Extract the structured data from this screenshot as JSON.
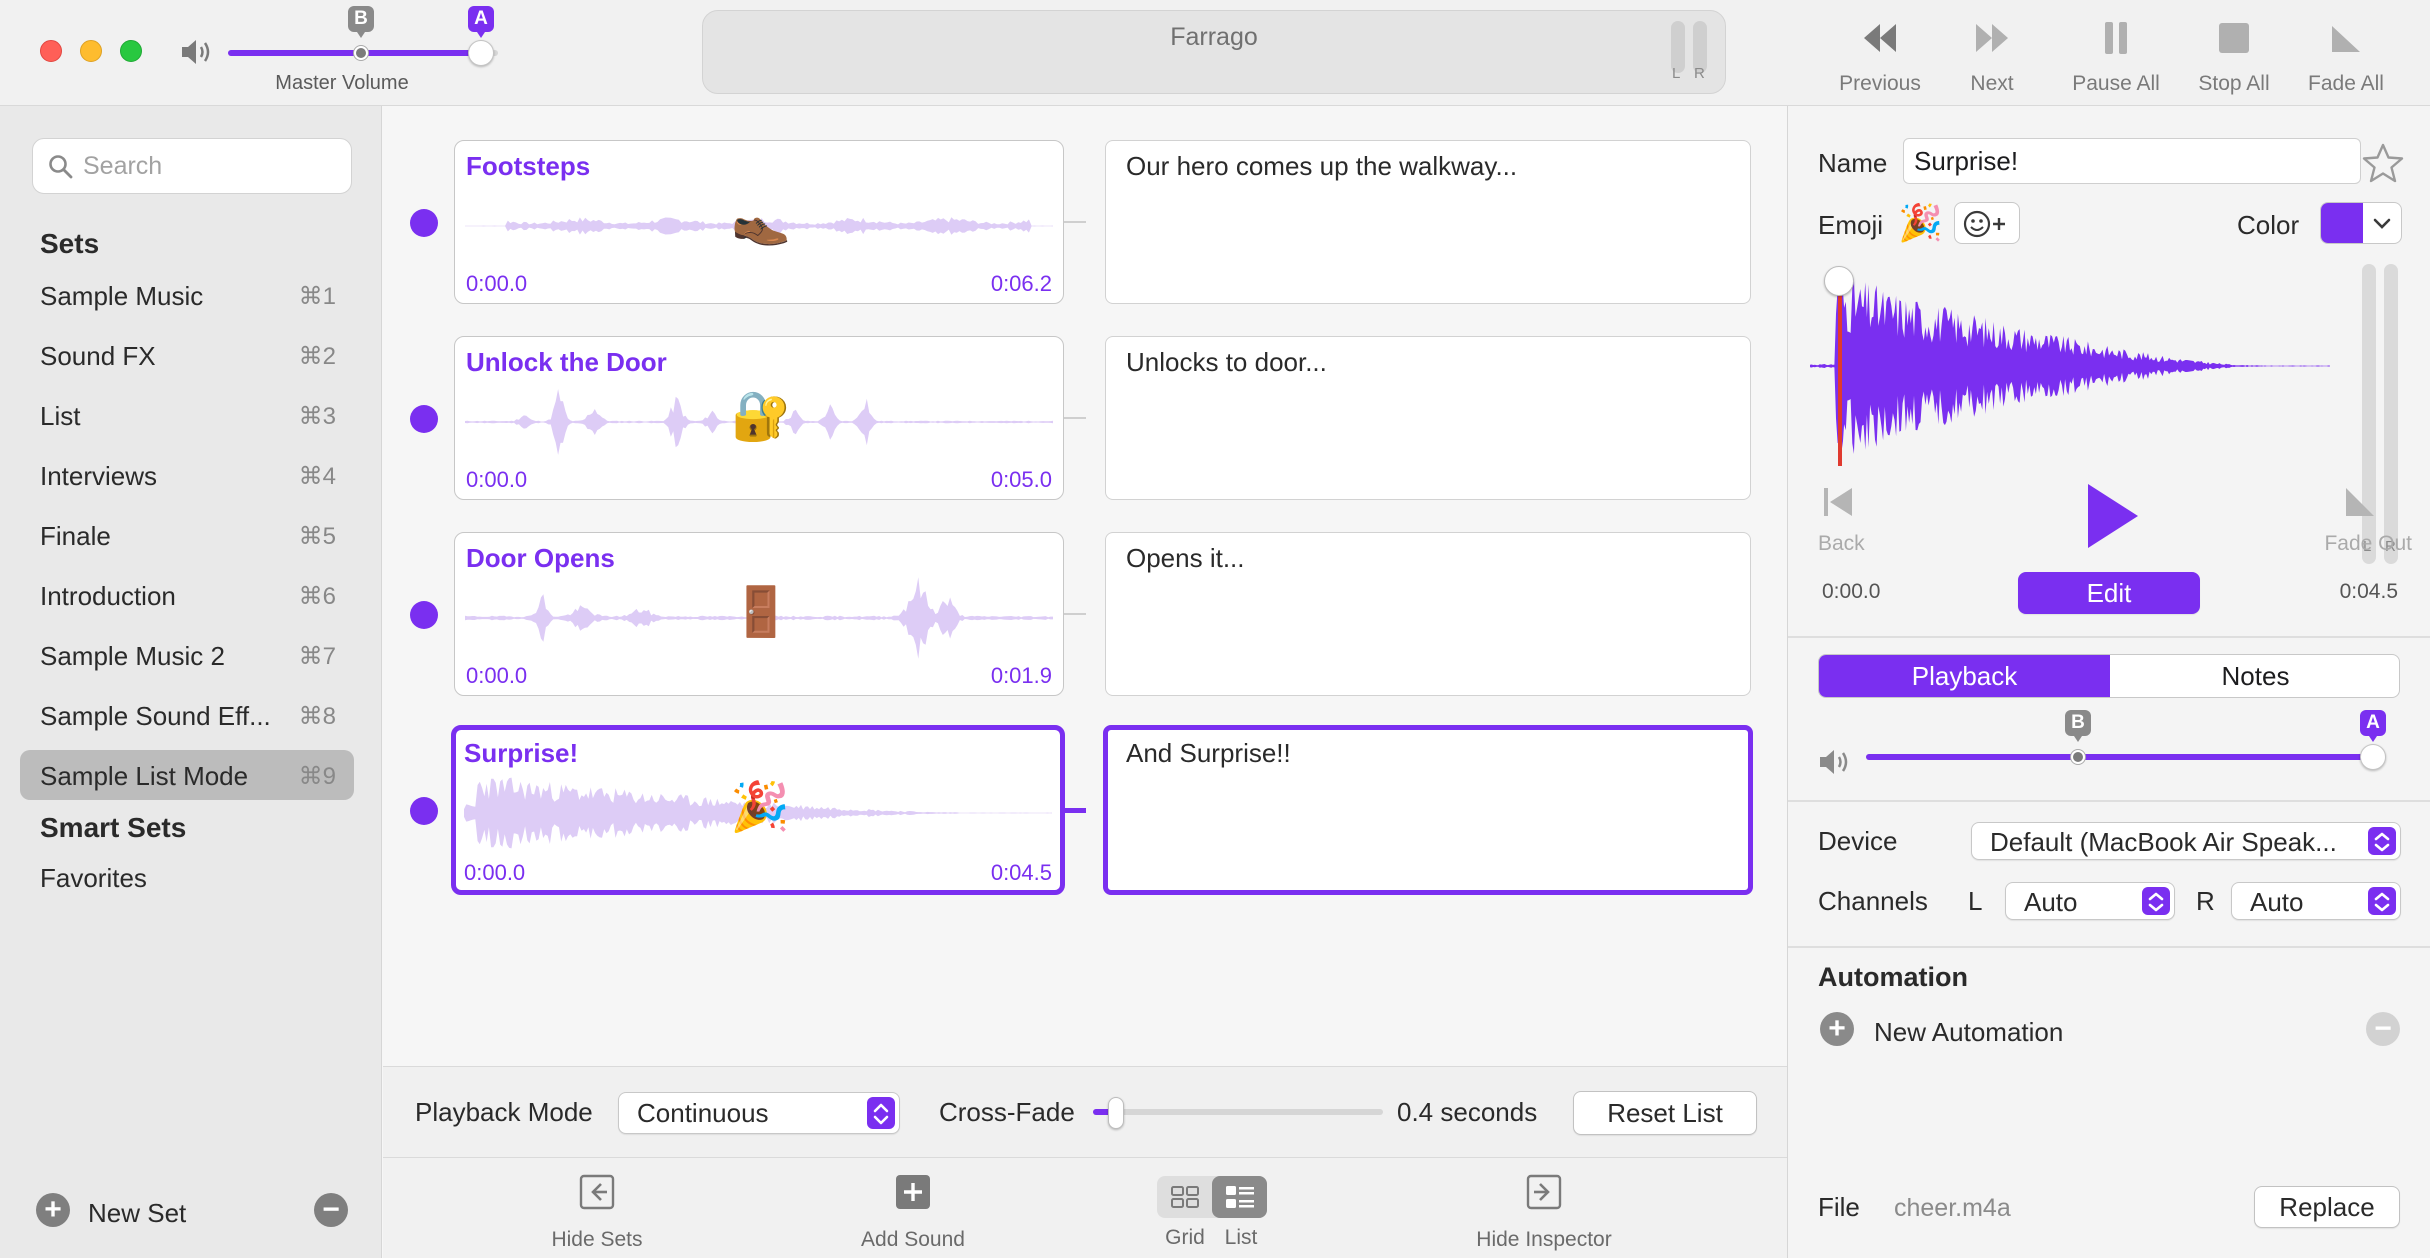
{
  "colors": {
    "accent": "#7a2ff0",
    "waveform_light": "#ddccf6",
    "playhead": "#e03a2f"
  },
  "titlebar": {
    "app_title": "Farrago",
    "master_volume_label": "Master Volume",
    "volume_badge_b": "B",
    "volume_badge_a": "A",
    "master_volume_level": 1.0,
    "master_volume_b_level": 0.53,
    "meter_l": "L",
    "meter_r": "R",
    "buttons": {
      "previous": "Previous",
      "next": "Next",
      "pause_all": "Pause All",
      "stop_all": "Stop All",
      "fade_all": "Fade All"
    }
  },
  "sidebar": {
    "search_placeholder": "Search",
    "sets_heading": "Sets",
    "items": [
      {
        "label": "Sample Music",
        "shortcut": "⌘1"
      },
      {
        "label": "Sound FX",
        "shortcut": "⌘2"
      },
      {
        "label": "List",
        "shortcut": "⌘3"
      },
      {
        "label": "Interviews",
        "shortcut": "⌘4"
      },
      {
        "label": "Finale",
        "shortcut": "⌘5"
      },
      {
        "label": "Introduction",
        "shortcut": "⌘6"
      },
      {
        "label": "Sample Music 2",
        "shortcut": "⌘7"
      },
      {
        "label": "Sample Sound Eff...",
        "shortcut": "⌘8"
      },
      {
        "label": "Sample List Mode",
        "shortcut": "⌘9"
      }
    ],
    "smart_sets_heading": "Smart Sets",
    "smart_items": [
      {
        "label": "Favorites"
      }
    ],
    "new_set_label": "New Set",
    "add_icon": "+",
    "remove_icon": "−"
  },
  "list": {
    "rows": [
      {
        "title": "Footsteps",
        "emoji": "👞",
        "start": "0:00.0",
        "end": "0:06.2",
        "note": "Our hero comes up the walkway..."
      },
      {
        "title": "Unlock the Door",
        "emoji": "🔐",
        "start": "0:00.0",
        "end": "0:05.0",
        "note": "Unlocks to door..."
      },
      {
        "title": "Door Opens",
        "emoji": "🚪",
        "start": "0:00.0",
        "end": "0:01.9",
        "note": "Opens it..."
      },
      {
        "title": "Surprise!",
        "emoji": "🎉",
        "start": "0:00.0",
        "end": "0:04.5",
        "note": "And Surprise!!"
      }
    ],
    "footer": {
      "playback_mode_label": "Playback Mode",
      "playback_mode_value": "Continuous",
      "crossfade_label": "Cross-Fade",
      "crossfade_value": "0.4 seconds",
      "crossfade_level": 0.08,
      "reset_label": "Reset List"
    },
    "toolbar": {
      "hide_sets": "Hide Sets",
      "add_sound": "Add Sound",
      "grid": "Grid",
      "list": "List",
      "hide_inspector": "Hide Inspector"
    }
  },
  "inspector": {
    "name_label": "Name",
    "name_value": "Surprise!",
    "emoji_label": "Emoji",
    "emoji_value": "🎉",
    "color_label": "Color",
    "back_label": "Back",
    "fade_out_label": "Fade Out",
    "time_start": "0:00.0",
    "time_end": "0:04.5",
    "edit_label": "Edit",
    "meter_l": "L",
    "meter_r": "R",
    "tabs": {
      "playback": "Playback",
      "notes": "Notes"
    },
    "volume_badge_b": "B",
    "volume_badge_a": "A",
    "volume_level": 1.0,
    "volume_b_level": 0.41,
    "device_label": "Device",
    "device_value": "Default (MacBook Air Speak...",
    "channels_label": "Channels",
    "channel_l_label": "L",
    "channel_l_value": "Auto",
    "channel_r_label": "R",
    "channel_r_value": "Auto",
    "automation_heading": "Automation",
    "new_automation_label": "New Automation",
    "add_icon": "+",
    "remove_icon": "−",
    "file_label": "File",
    "file_value": "cheer.m4a",
    "replace_label": "Replace"
  }
}
